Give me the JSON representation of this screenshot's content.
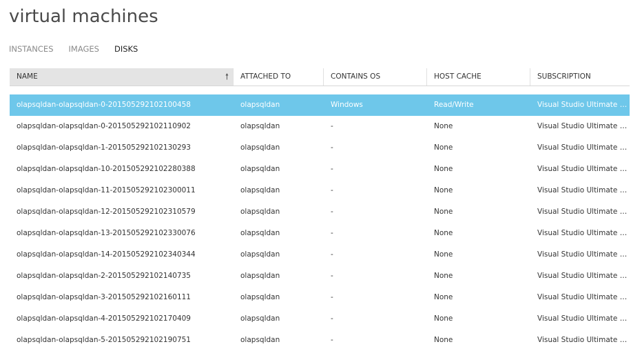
{
  "header": {
    "title": "virtual machines"
  },
  "tabs": [
    {
      "label": "INSTANCES"
    },
    {
      "label": "IMAGES"
    },
    {
      "label": "DISKS"
    }
  ],
  "table": {
    "columns": [
      {
        "label": "NAME"
      },
      {
        "label": "ATTACHED TO"
      },
      {
        "label": "CONTAINS OS"
      },
      {
        "label": "HOST CACHE"
      },
      {
        "label": "SUBSCRIPTION"
      }
    ],
    "sort_icon": "up-arrow-icon",
    "rows": [
      {
        "name": "olapsqldan-olapsqldan-0-201505292102100458",
        "attached": "olapsqldan",
        "os": "Windows",
        "cache": "Read/Write",
        "subscription": "Visual Studio Ultimate with..."
      },
      {
        "name": "olapsqldan-olapsqldan-0-201505292102110902",
        "attached": "olapsqldan",
        "os": "-",
        "cache": "None",
        "subscription": "Visual Studio Ultimate with..."
      },
      {
        "name": "olapsqldan-olapsqldan-1-201505292102130293",
        "attached": "olapsqldan",
        "os": "-",
        "cache": "None",
        "subscription": "Visual Studio Ultimate with..."
      },
      {
        "name": "olapsqldan-olapsqldan-10-201505292102280388",
        "attached": "olapsqldan",
        "os": "-",
        "cache": "None",
        "subscription": "Visual Studio Ultimate with..."
      },
      {
        "name": "olapsqldan-olapsqldan-11-201505292102300011",
        "attached": "olapsqldan",
        "os": "-",
        "cache": "None",
        "subscription": "Visual Studio Ultimate with..."
      },
      {
        "name": "olapsqldan-olapsqldan-12-201505292102310579",
        "attached": "olapsqldan",
        "os": "-",
        "cache": "None",
        "subscription": "Visual Studio Ultimate with..."
      },
      {
        "name": "olapsqldan-olapsqldan-13-201505292102330076",
        "attached": "olapsqldan",
        "os": "-",
        "cache": "None",
        "subscription": "Visual Studio Ultimate with..."
      },
      {
        "name": "olapsqldan-olapsqldan-14-201505292102340344",
        "attached": "olapsqldan",
        "os": "-",
        "cache": "None",
        "subscription": "Visual Studio Ultimate with..."
      },
      {
        "name": "olapsqldan-olapsqldan-2-201505292102140735",
        "attached": "olapsqldan",
        "os": "-",
        "cache": "None",
        "subscription": "Visual Studio Ultimate with..."
      },
      {
        "name": "olapsqldan-olapsqldan-3-201505292102160111",
        "attached": "olapsqldan",
        "os": "-",
        "cache": "None",
        "subscription": "Visual Studio Ultimate with..."
      },
      {
        "name": "olapsqldan-olapsqldan-4-201505292102170409",
        "attached": "olapsqldan",
        "os": "-",
        "cache": "None",
        "subscription": "Visual Studio Ultimate with..."
      },
      {
        "name": "olapsqldan-olapsqldan-5-201505292102190751",
        "attached": "olapsqldan",
        "os": "-",
        "cache": "None",
        "subscription": "Visual Studio Ultimate with..."
      }
    ]
  }
}
